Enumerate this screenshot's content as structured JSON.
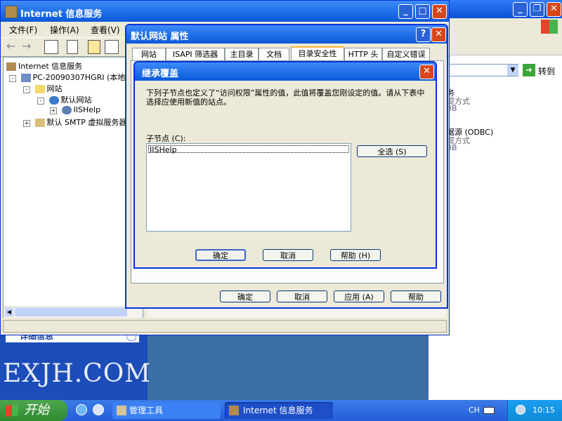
{
  "bg_window": {
    "title": "Internet 信息服务",
    "menus": [
      "文件(F)",
      "操作(A)",
      "查看(V)"
    ],
    "tree": {
      "root": "Internet 信息服务",
      "computer": "PC-20090307HGRI (本地计",
      "websites": "网站",
      "default_site": "默认网站",
      "iishelp": "IISHelp",
      "smtp": "默认 SMTP 虚拟服务器"
    },
    "right_partial": {
      "line1": "务",
      "line2": "提方式",
      "line3": "ЗB",
      "line4": "据源 (ODBC)",
      "line5": "提方式",
      "line6": "ЗB"
    },
    "go_label": "转到"
  },
  "left_panel": {
    "details_label": "详细信息",
    "watermark": "EXJH.COM"
  },
  "props_dialog": {
    "title": "默认网站 属性",
    "tabs": [
      "网站",
      "ISAPI 筛选器",
      "主目录",
      "文档",
      "目录安全性",
      "HTTP 头",
      "自定义错误"
    ],
    "active_tab": "目录安全性",
    "buttons": {
      "ok": "确定",
      "cancel": "取消",
      "apply": "应用 (A)",
      "help": "帮助"
    }
  },
  "inherit_dialog": {
    "title": "继承覆盖",
    "message": "下列子节点也定义了“访问权限”属性的值，此值将覆盖您刚设定的值。请从下表中选择应使用新值的站点。",
    "child_label": "子节点 (C):",
    "list_items": [
      "IISHelp"
    ],
    "select_all": "全选 (S)",
    "ok": "确定",
    "cancel": "取消",
    "help": "帮助 (H)"
  },
  "taskbar": {
    "start": "开始",
    "items": [
      "管理工具",
      "Internet 信息服务"
    ],
    "lang": "CH",
    "clock": "10:15"
  },
  "colors": {
    "title_blue": "#0a58d8",
    "dialog_face": "#ece9d8",
    "taskbar_blue": "#245edb",
    "start_green": "#3c8f3c",
    "close_red": "#d8461c"
  }
}
